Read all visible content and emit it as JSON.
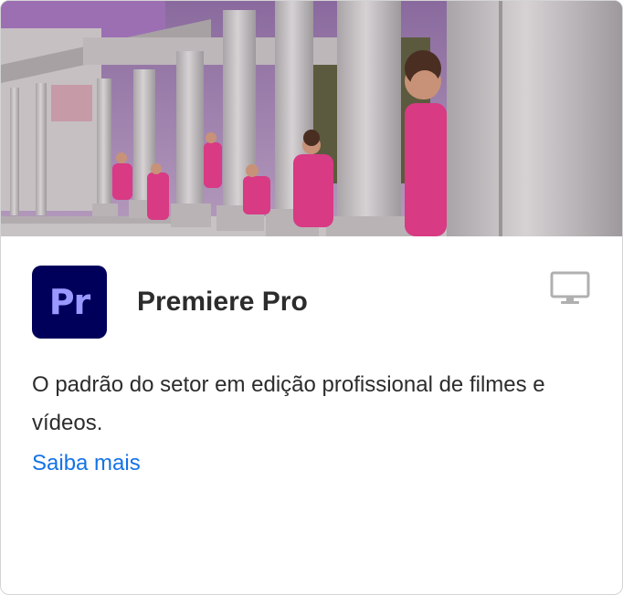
{
  "product": {
    "icon_text": "Pr",
    "title": "Premiere Pro",
    "description": "O padrão do setor em edição profissional de filmes e vídeos.",
    "learn_more": "Saiba mais",
    "platform_icon": "desktop-monitor-icon"
  },
  "hero_image": {
    "semantic": "people in pink hoodies peeking from behind stone colonnade"
  },
  "colors": {
    "icon_background": "#00005b",
    "icon_text": "#9999ff",
    "link": "#1473e6",
    "title": "#2c2c2c",
    "hoodie": "#d83a84"
  }
}
